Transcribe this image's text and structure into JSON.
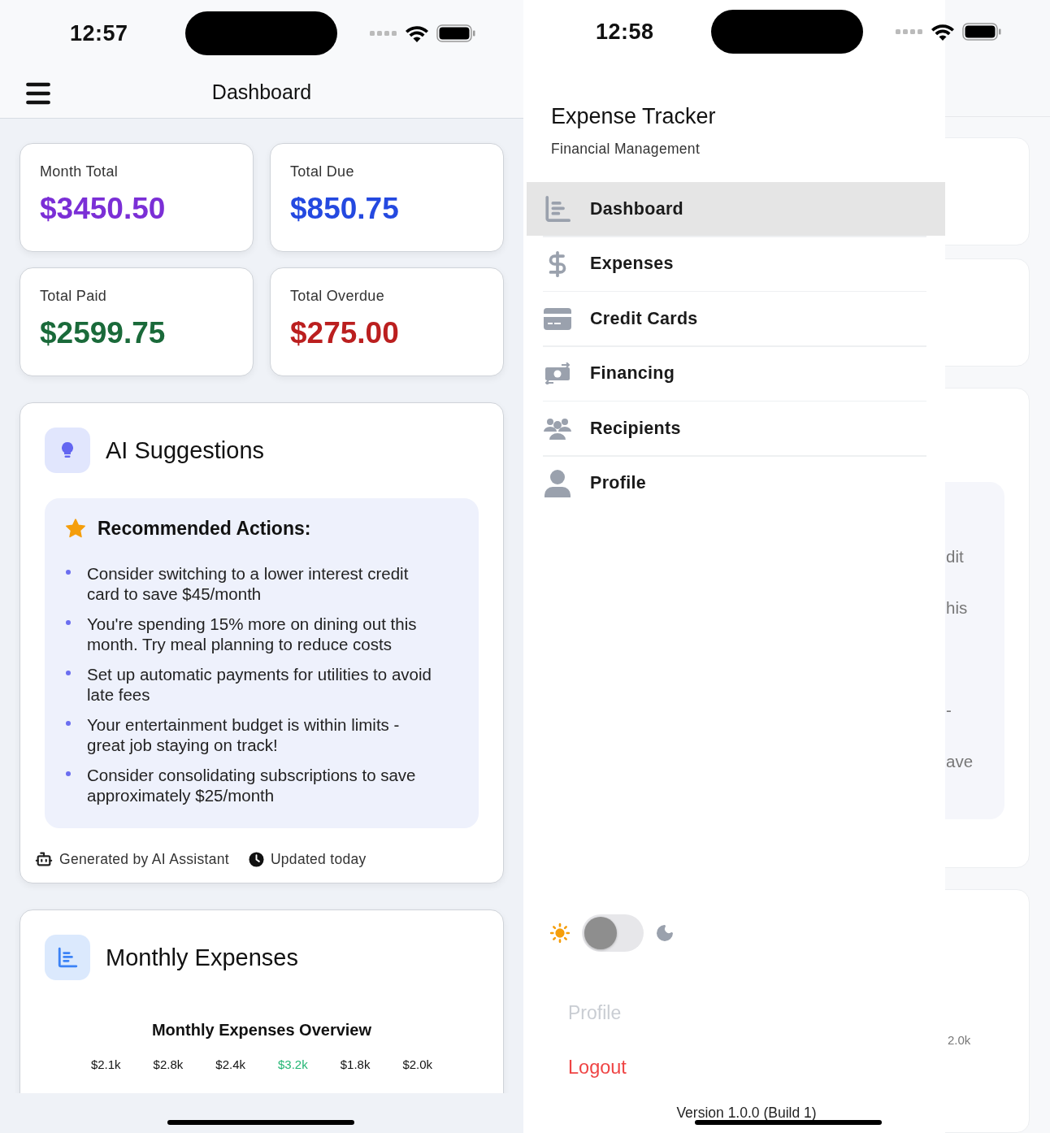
{
  "dashboard_screen": {
    "status_bar": {
      "time": "12:57"
    },
    "header": {
      "title": "Dashboard"
    },
    "stat_cards": [
      {
        "label": "Month Total",
        "value": "$3450.50",
        "color": "#7b2fd6"
      },
      {
        "label": "Total Due",
        "value": "$850.75",
        "color": "#2449e0"
      },
      {
        "label": "Total Paid",
        "value": "$2599.75",
        "color": "#1a6a3a"
      },
      {
        "label": "Total Overdue",
        "value": "$275.00",
        "color": "#bb1f1f"
      }
    ],
    "ai_card": {
      "title": "AI Suggestions",
      "box_title": "Recommended Actions:",
      "items": [
        "Consider switching to a lower interest credit card to save $45/month",
        "You're spending 15% more on dining out this month. Try meal planning to reduce costs",
        "Set up automatic payments for utilities to avoid late fees",
        "Your entertainment budget is within limits - great job staying on track!",
        "Consider consolidating subscriptions to save approximately $25/month"
      ],
      "footer": [
        {
          "kind": "robot",
          "text": "Generated by AI Assistant"
        },
        {
          "kind": "clock",
          "text": "Updated today"
        }
      ]
    },
    "monthly_card": {
      "title": "Monthly Expenses",
      "chart_title": "Monthly Expenses Overview",
      "values": [
        {
          "label": "$2.1k",
          "highlighted": false
        },
        {
          "label": "$2.8k",
          "highlighted": false
        },
        {
          "label": "$2.4k",
          "highlighted": false
        },
        {
          "label": "$3.2k",
          "highlighted": true
        },
        {
          "label": "$1.8k",
          "highlighted": false
        },
        {
          "label": "$2.0k",
          "highlighted": false
        }
      ]
    }
  },
  "drawer_screen": {
    "status_bar": {
      "time": "12:58"
    },
    "drawer": {
      "title": "Expense Tracker",
      "subtitle": "Financial Management",
      "items": [
        {
          "label": "Dashboard",
          "kind": "chart",
          "selected": true
        },
        {
          "label": "Expenses",
          "kind": "dollar",
          "selected": false
        },
        {
          "label": "Credit Cards",
          "kind": "card",
          "selected": false
        },
        {
          "label": "Financing",
          "kind": "money",
          "selected": false
        },
        {
          "label": "Recipients",
          "kind": "people",
          "selected": false
        },
        {
          "label": "Profile",
          "kind": "person",
          "selected": false
        }
      ],
      "theme_toggle": {
        "on": false
      },
      "faded_label": "Profile",
      "logout": "Logout",
      "version": "Version 1.0.0 (Build 1)"
    },
    "backdrop": {
      "lines": [
        "dit",
        "his",
        "-",
        "ave"
      ],
      "value": "2.0k"
    }
  }
}
